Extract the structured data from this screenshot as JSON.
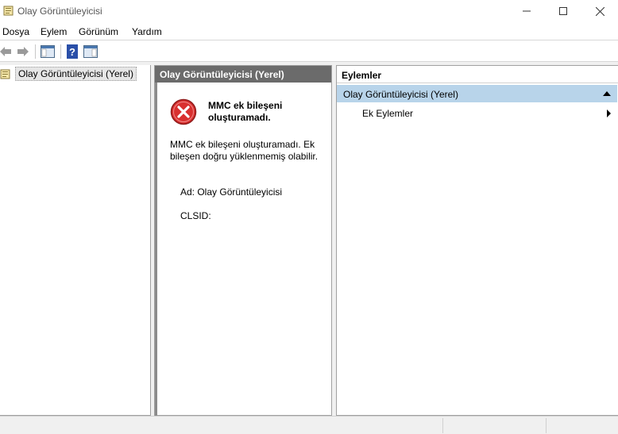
{
  "window": {
    "title": "Olay Görüntüleyicisi"
  },
  "menu": {
    "items": [
      "Dosya",
      "Eylem",
      "Görünüm",
      "Yardım"
    ]
  },
  "toolbar": {
    "buttons": [
      "back-arrow-icon",
      "forward-arrow-icon",
      "show-hide-console-tree-icon",
      "help-icon",
      "show-hide-action-pane-icon"
    ]
  },
  "tree": {
    "root_label": "Olay Görüntüleyicisi (Yerel)"
  },
  "main": {
    "header": "Olay Görüntüleyicisi (Yerel)",
    "error_title": "MMC ek bileşeni oluşturamadı.",
    "error_desc": "MMC ek bileşeni oluşturamadı. Ek bileşen doğru yüklenmemiş olabilir.",
    "name_line": "Ad: Olay Görüntüleyicisi",
    "clsid_line": "CLSID:"
  },
  "actions": {
    "header": "Eylemler",
    "section_label": "Olay Görüntüleyicisi (Yerel)",
    "item_label": "Ek Eylemler"
  },
  "colors": {
    "selected_section": "#b8d4ea",
    "pane_header": "#6b6b6b",
    "error_red": "#d9302f"
  }
}
